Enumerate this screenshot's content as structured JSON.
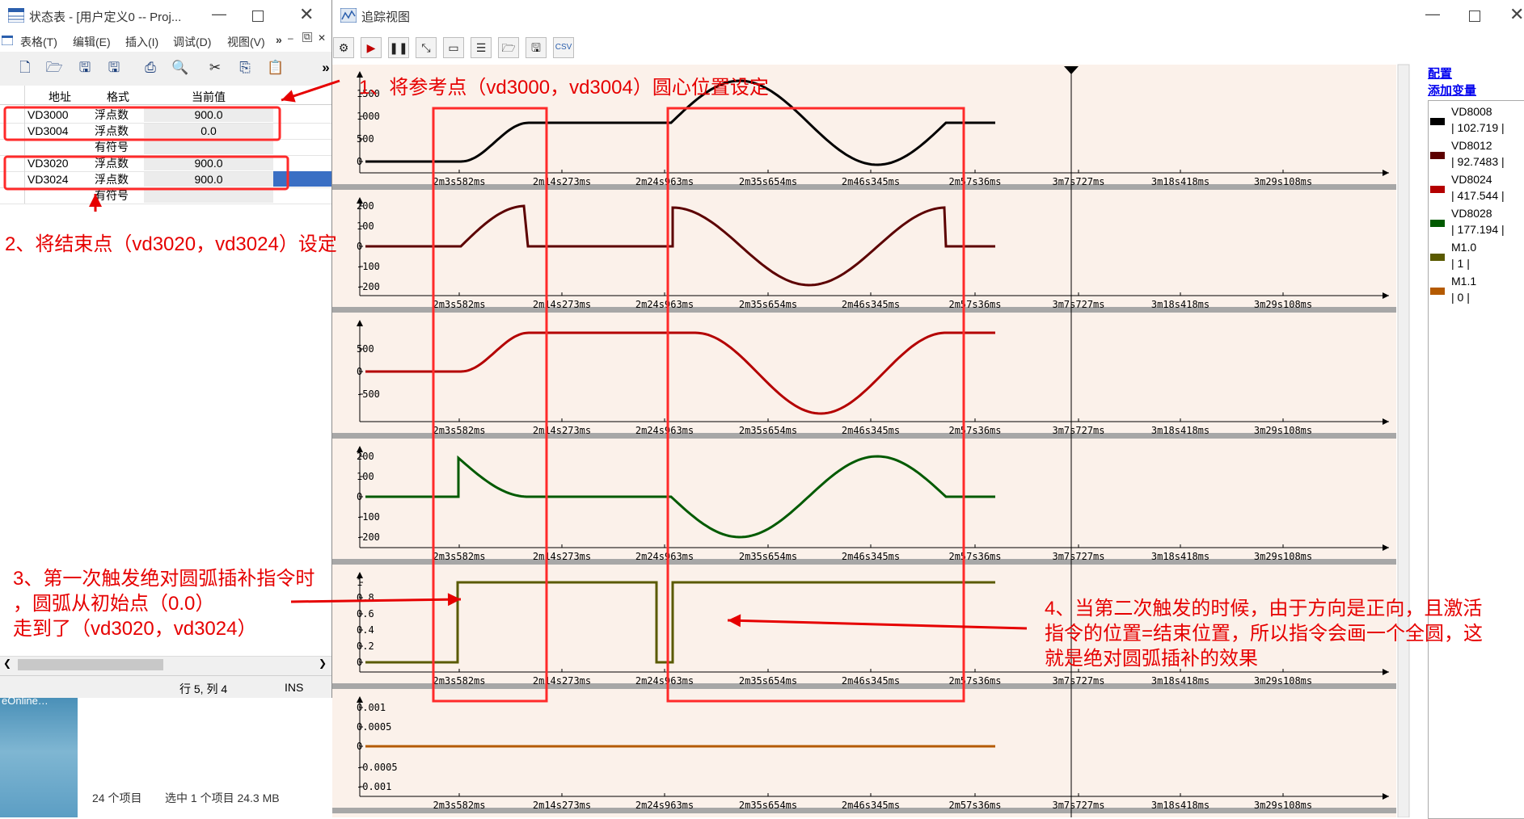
{
  "left_window": {
    "title": "状态表 - [用户定义0 -- Proj...",
    "menu": [
      "表格(T)",
      "编辑(E)",
      "插入(I)",
      "调试(D)",
      "视图(V)"
    ],
    "menu_more": "»",
    "toolbar_more": "»",
    "columns": [
      "地址",
      "格式",
      "当前值"
    ],
    "rows": [
      {
        "addr": "VD3000",
        "fmt": "浮点数",
        "val": "900.0"
      },
      {
        "addr": "VD3004",
        "fmt": "浮点数",
        "val": "0.0"
      },
      {
        "addr": "",
        "fmt": "有符号",
        "val": ""
      },
      {
        "addr": "VD3020",
        "fmt": "浮点数",
        "val": "900.0"
      },
      {
        "addr": "VD3024",
        "fmt": "浮点数",
        "val": "900.0"
      },
      {
        "addr": "",
        "fmt": "有符号",
        "val": ""
      }
    ],
    "status_pos": "行 5, 列 4",
    "status_mode": "INS",
    "explorer_status": [
      "24 个项目",
      "选中 1 个项目  24.3 MB"
    ],
    "desktop_text": "eOnline…"
  },
  "right_window": {
    "title": "追踪视图",
    "side_links": [
      "配置",
      "添加变量"
    ],
    "legend": [
      {
        "name": "VD8008",
        "value": "| 102.719 |",
        "color": "#000000"
      },
      {
        "name": "VD8012",
        "value": "| 92.7483 |",
        "color": "#5c0000"
      },
      {
        "name": "VD8024",
        "value": "| 417.544 |",
        "color": "#b40000"
      },
      {
        "name": "VD8028",
        "value": "| 177.194 |",
        "color": "#005a00"
      },
      {
        "name": "M1.0",
        "value": "| 1 |",
        "color": "#5a5a00"
      },
      {
        "name": "M1.1",
        "value": "| 0 |",
        "color": "#b45a00"
      }
    ],
    "time_labels": [
      "2m3s582ms",
      "2m14s273ms",
      "2m24s963ms",
      "2m35s654ms",
      "2m46s345ms",
      "2m57s36ms",
      "3m7s727ms",
      "3m18s418ms",
      "3m29s108ms"
    ],
    "plots": [
      {
        "series": "VD8008",
        "ticks": [
          "1500",
          "1000",
          "500",
          "0"
        ]
      },
      {
        "series": "VD8012",
        "ticks": [
          "200",
          "100",
          "0",
          "-100",
          "-200"
        ]
      },
      {
        "series": "VD8024",
        "ticks": [
          "500",
          "0",
          "-500"
        ]
      },
      {
        "series": "VD8028",
        "ticks": [
          "200",
          "100",
          "0",
          "-100",
          "-200"
        ]
      },
      {
        "series": "M1.0",
        "ticks": [
          "1",
          "0.8",
          "0.6",
          "0.4",
          "0.2",
          "0"
        ]
      },
      {
        "series": "M1.1",
        "ticks": [
          "0.001",
          "0.0005",
          "0",
          "-0.0005",
          "-0.001"
        ]
      }
    ]
  },
  "annotations": {
    "a1": "1、将参考点（vd3000，vd3004）圆心位置设定",
    "a2": "2、将结束点（vd3020，vd3024）设定",
    "a3": [
      "3、第一次触发绝对圆弧插补指令时",
      "，圆弧从初始点（0.0）",
      "走到了（vd3020，vd3024）"
    ],
    "a4": [
      "4、当第二次触发的时候，由于方向是正向，且激活",
      "指令的位置=结束位置，所以指令会画一个全圆，这",
      "就是绝对圆弧插补的效果"
    ]
  }
}
